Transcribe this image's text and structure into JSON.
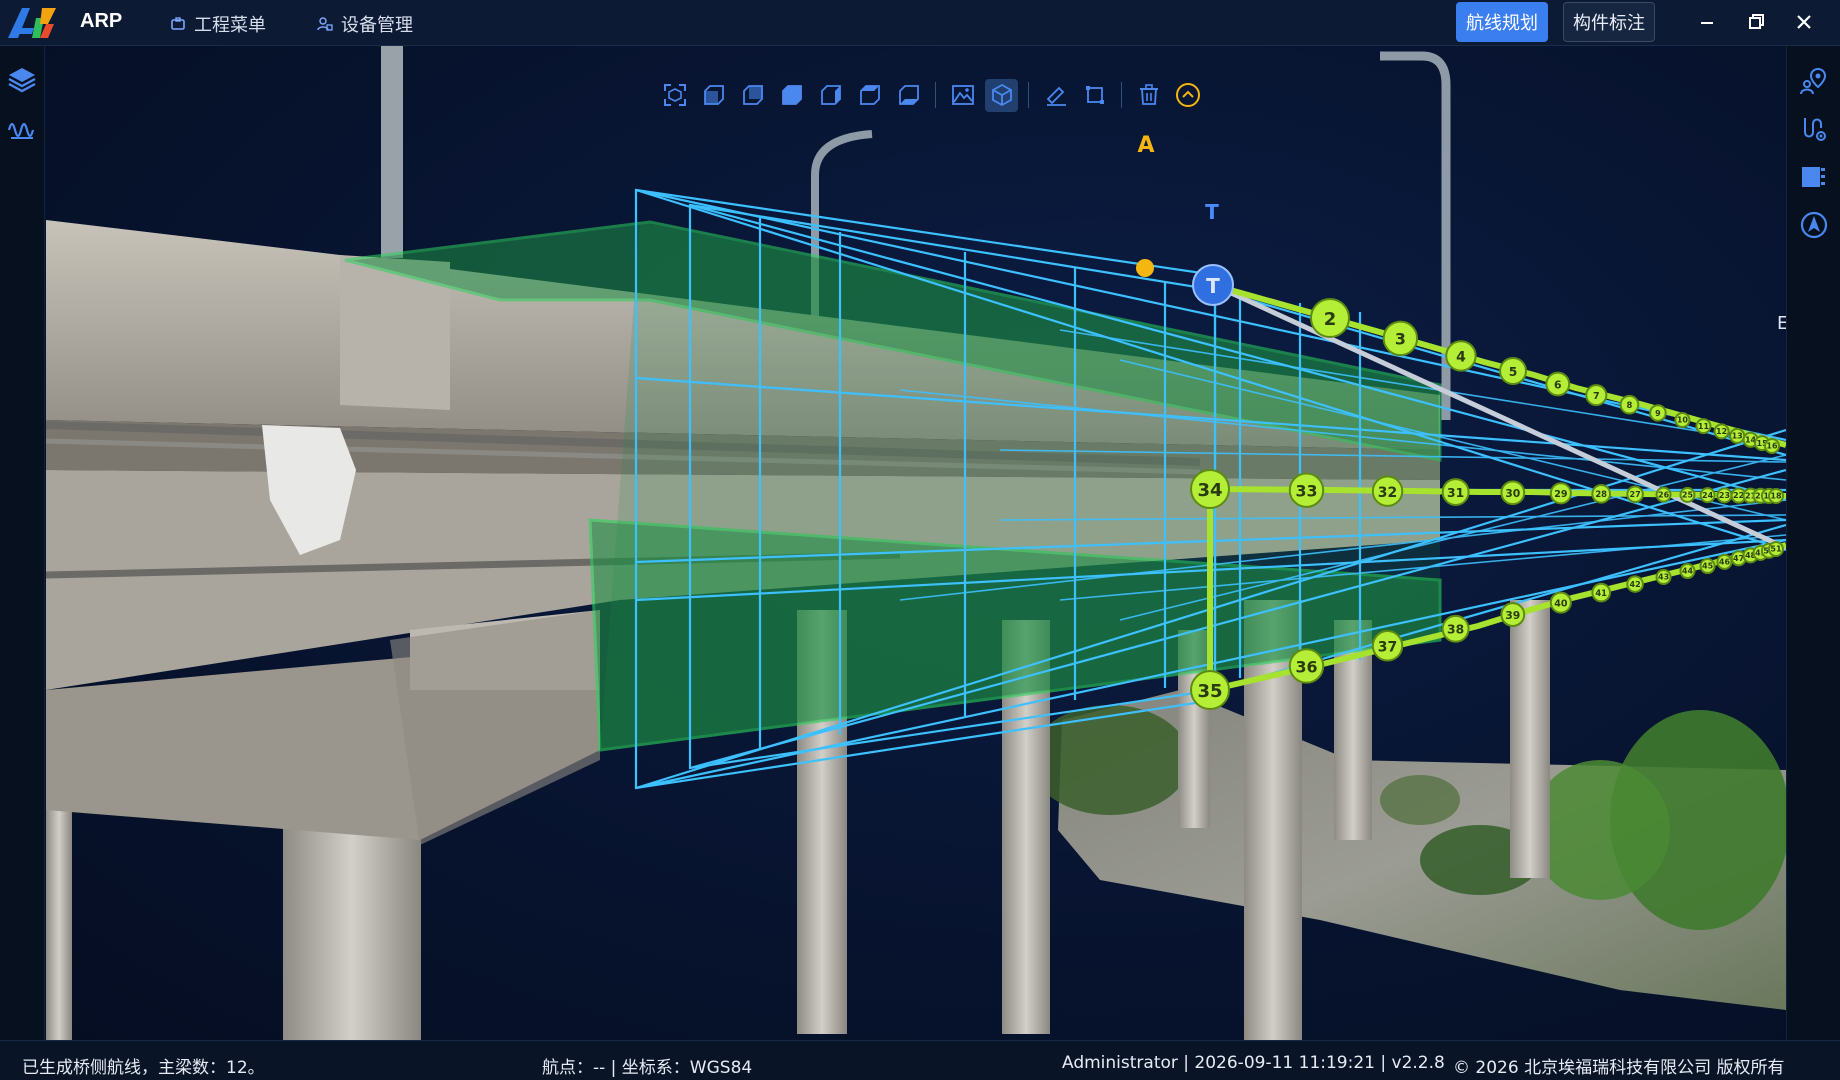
{
  "app": {
    "name": "ARP"
  },
  "menu": {
    "project": "工程菜单",
    "device": "设备管理"
  },
  "header": {
    "route_planning": "航线规划",
    "component_annotation": "构件标注"
  },
  "scene": {
    "label_a": "A",
    "label_t": "T",
    "edge_letter": "E",
    "top_waypoints": [
      "2",
      "3",
      "4",
      "5",
      "6",
      "7",
      "8",
      "9",
      "10",
      "11",
      "12",
      "13",
      "14",
      "15",
      "16"
    ],
    "middle_waypoints": [
      "34",
      "33",
      "32",
      "31",
      "30",
      "29",
      "28",
      "27",
      "26",
      "25",
      "24",
      "23",
      "22",
      "21",
      "20",
      "19",
      "18"
    ],
    "bottom_waypoints": [
      "35",
      "36",
      "37",
      "38",
      "39",
      "40",
      "41",
      "42",
      "43",
      "44",
      "45",
      "46",
      "47",
      "48",
      "49",
      "50",
      "51"
    ]
  },
  "status": {
    "message": "已生成桥侧航线，主梁数：12。",
    "waypoint_coord": "航点：-- | 坐标系：WGS84",
    "user_info": "Administrator | 2026-09-11 11:19:21 | v2.2.8",
    "copyright": "© 2026 北京埃福瑞科技有限公司 版权所有"
  },
  "colors": {
    "accent": "#3b7ef0",
    "route_line": "#a6e22e",
    "box_line": "#3cc0ff",
    "green_volume": "#1e8f45",
    "background": "#07132e"
  },
  "icons": {
    "toolbar": [
      "view-reset-icon",
      "view-front-icon",
      "view-back-icon",
      "view-left-icon",
      "view-right-icon",
      "view-top-icon",
      "view-bottom-icon",
      "terrain-icon",
      "model-icon",
      "measure-icon",
      "area-icon",
      "delete-icon",
      "collapse-up-icon"
    ],
    "left": [
      "layers-icon",
      "waveform-icon"
    ],
    "right": [
      "map-pin-user-icon",
      "route-settings-icon",
      "component-icon",
      "navigation-icon"
    ]
  }
}
